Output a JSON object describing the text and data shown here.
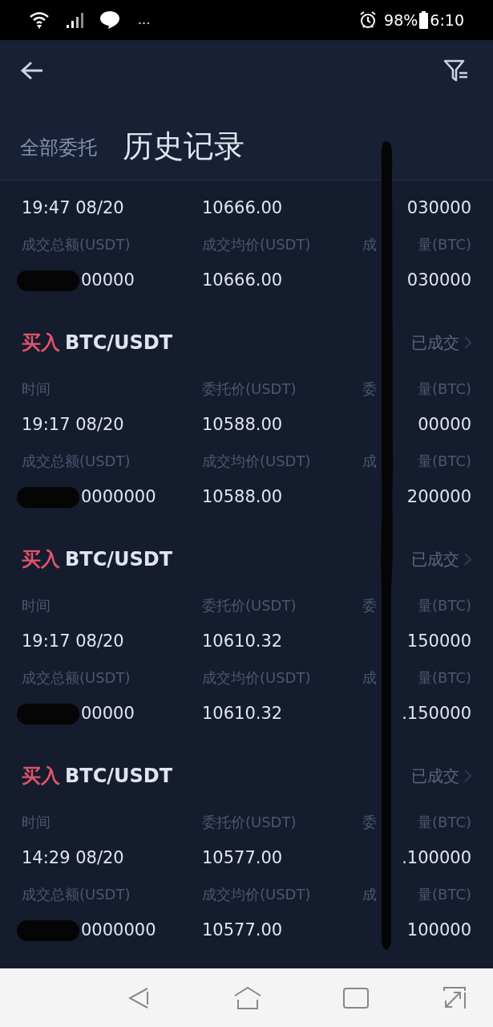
{
  "status_bar": {
    "more": "...",
    "battery": "98%",
    "time": "6:10"
  },
  "tabs": [
    {
      "label": "全部委托",
      "selected": false
    },
    {
      "label": "历史记录",
      "selected": true
    }
  ],
  "orders": [
    {
      "rows": [
        {
          "kind": "value",
          "cells": [
            {
              "text": "19:47 08/20"
            },
            {
              "text": "10666.00"
            },
            {
              "tail": "030000"
            }
          ]
        },
        {
          "kind": "label",
          "cells": [
            {
              "text": "成交总额(USDT)"
            },
            {
              "text": "成交均价(USDT)"
            },
            {
              "head": "成",
              "tail": "量(BTC)"
            }
          ]
        },
        {
          "kind": "value",
          "cells": [
            {
              "text": "00000",
              "redacted": true
            },
            {
              "text": "10666.00"
            },
            {
              "tail": "030000"
            }
          ]
        }
      ]
    },
    {
      "side": "买入",
      "pair": "BTC/USDT",
      "status": "已成交",
      "rows": [
        {
          "kind": "label",
          "cells": [
            {
              "text": "时间"
            },
            {
              "text": "委托价(USDT)"
            },
            {
              "head": "委",
              "tail": "量(BTC)"
            }
          ]
        },
        {
          "kind": "value",
          "cells": [
            {
              "text": "19:17 08/20"
            },
            {
              "text": "10588.00"
            },
            {
              "tail": "00000"
            }
          ]
        },
        {
          "kind": "label",
          "cells": [
            {
              "text": "成交总额(USDT)"
            },
            {
              "text": "成交均价(USDT)"
            },
            {
              "head": "成",
              "tail": "量(BTC)"
            }
          ]
        },
        {
          "kind": "value",
          "cells": [
            {
              "text": "0000000",
              "redacted": true
            },
            {
              "text": "10588.00"
            },
            {
              "tail": "200000"
            }
          ]
        }
      ]
    },
    {
      "side": "买入",
      "pair": "BTC/USDT",
      "status": "已成交",
      "rows": [
        {
          "kind": "label",
          "cells": [
            {
              "text": "时间"
            },
            {
              "text": "委托价(USDT)"
            },
            {
              "head": "委",
              "tail": "量(BTC)"
            }
          ]
        },
        {
          "kind": "value",
          "cells": [
            {
              "text": "19:17 08/20"
            },
            {
              "text": "10610.32"
            },
            {
              "tail": "150000"
            }
          ]
        },
        {
          "kind": "label",
          "cells": [
            {
              "text": "成交总额(USDT)"
            },
            {
              "text": "成交均价(USDT)"
            },
            {
              "head": "成",
              "tail": "量(BTC)"
            }
          ]
        },
        {
          "kind": "value",
          "cells": [
            {
              "text": "00000",
              "redacted": true
            },
            {
              "text": "10610.32"
            },
            {
              "tail": ".150000"
            }
          ]
        }
      ]
    },
    {
      "side": "买入",
      "pair": "BTC/USDT",
      "status": "已成交",
      "rows": [
        {
          "kind": "label",
          "cells": [
            {
              "text": "时间"
            },
            {
              "text": "委托价(USDT)"
            },
            {
              "head": "委",
              "tail": "量(BTC)"
            }
          ]
        },
        {
          "kind": "value",
          "cells": [
            {
              "text": "14:29 08/20"
            },
            {
              "text": "10577.00"
            },
            {
              "tail": ".100000"
            }
          ]
        },
        {
          "kind": "label",
          "cells": [
            {
              "text": "成交总额(USDT)"
            },
            {
              "text": "成交均价(USDT)"
            },
            {
              "head": "成",
              "tail": "量(BTC)"
            }
          ]
        },
        {
          "kind": "value",
          "cells": [
            {
              "text": "0000000",
              "redacted": true
            },
            {
              "text": "10577.00"
            },
            {
              "tail": "100000"
            }
          ]
        }
      ]
    }
  ]
}
